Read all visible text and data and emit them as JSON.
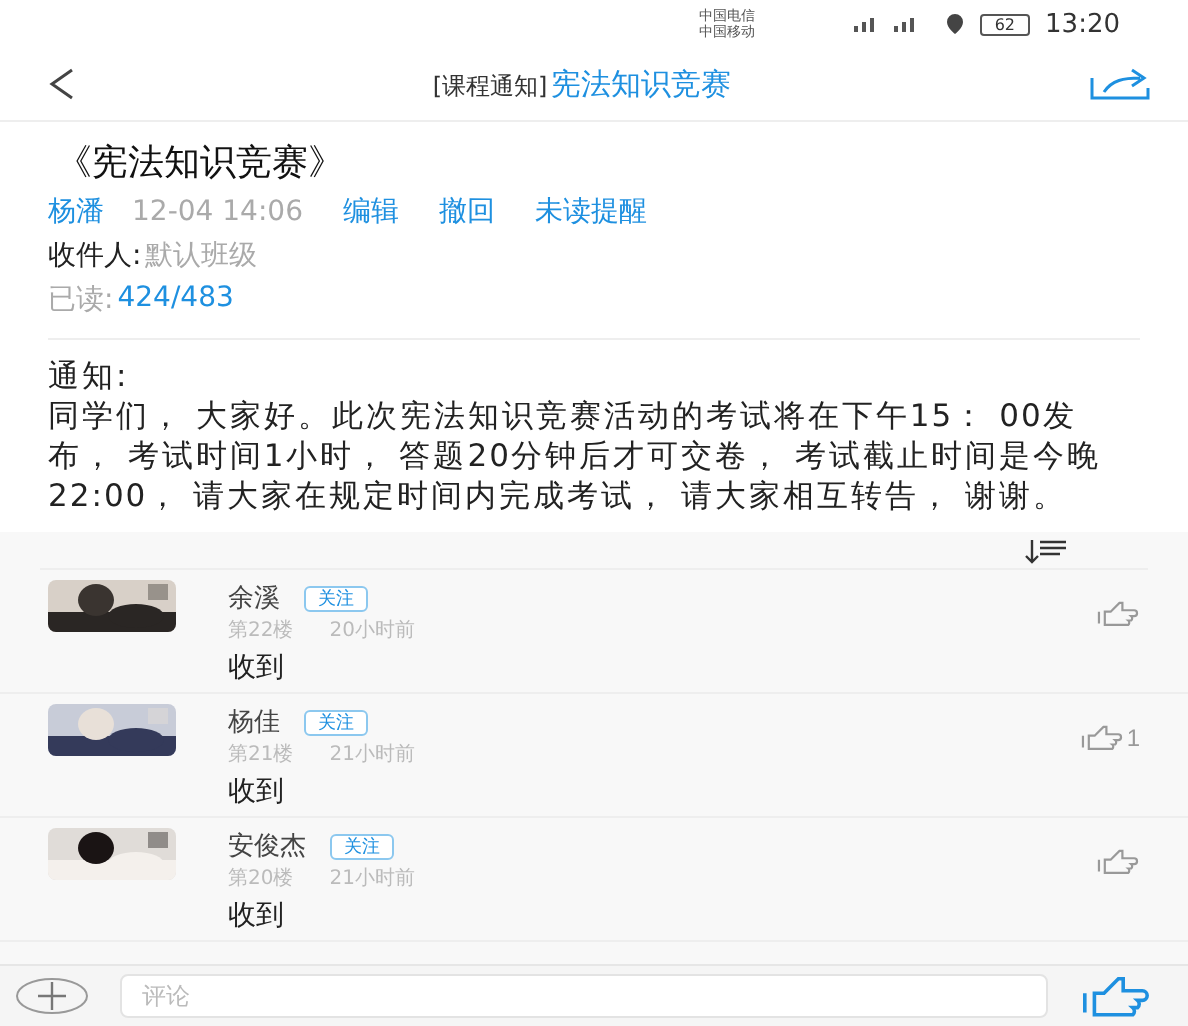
{
  "status_bar": {
    "carriers": [
      "中国电信",
      "中国移动"
    ],
    "battery": "62",
    "time": "13:20"
  },
  "header": {
    "prefix": "[课程通知]",
    "title": "宪法知识竞赛"
  },
  "notice": {
    "title": "《宪法知识竞赛》",
    "author": "杨潘",
    "time": "12-04 14:06",
    "actions": [
      "编辑",
      "撤回",
      "未读提醒"
    ],
    "recipients_label": "收件人:",
    "recipients": "默认班级",
    "read_label": "已读:",
    "read_count": "424/483",
    "body_label": "通知:",
    "body": "同学们， 大家好。此次宪法知识竞赛活动的考试将在下午15： 00发布， 考试时间1小时， 答题20分钟后才可交卷， 考试截止时间是今晚22:00， 请大家在规定时间内完成考试， 请大家相互转告， 谢谢。"
  },
  "comments": [
    {
      "name": "余溪",
      "follow": "关注",
      "floor": "第22楼",
      "time": "20小时前",
      "text": "收到"
    },
    {
      "name": "杨佳",
      "follow": "关注",
      "floor": "第21楼",
      "time": "21小时前",
      "text": "收到",
      "likes": "1"
    },
    {
      "name": "安俊杰",
      "follow": "关注",
      "floor": "第20楼",
      "time": "21小时前",
      "text": "收到"
    }
  ],
  "comment_bar": {
    "placeholder": "评论"
  }
}
